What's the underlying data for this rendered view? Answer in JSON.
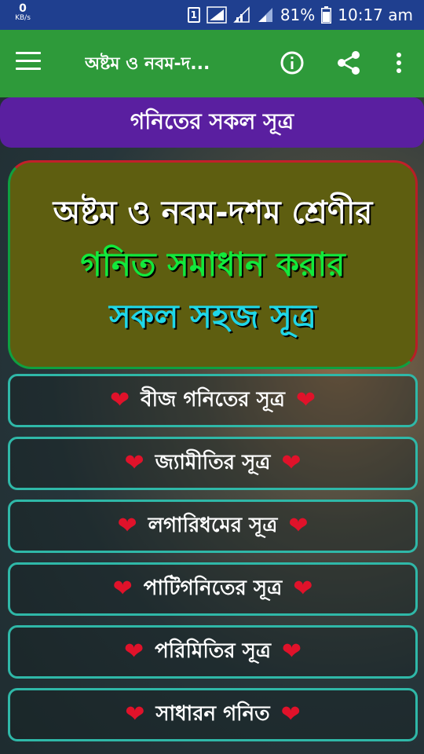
{
  "status_bar": {
    "net_speed_value": "0",
    "net_speed_unit": "KB/s",
    "sim_slot": "1",
    "battery": "81%",
    "time": "10:17 am"
  },
  "toolbar": {
    "title": "অষ্টম ও নবম-দ...",
    "icons": [
      "menu-icon",
      "info-icon",
      "share-icon",
      "more-vert-icon"
    ]
  },
  "heading": "গনিতের সকল সূত্র",
  "banner": {
    "line1": "অষ্টম ও নবম-দশম শ্রেণীর",
    "line2": "গনিত সমাধান করার",
    "line3": "সকল সহজ সূত্র"
  },
  "menu_items": [
    {
      "label": "বীজ গনিতের সূত্র"
    },
    {
      "label": "জ্যামীতির সূত্র"
    },
    {
      "label": "লগারিধমের সূত্র"
    },
    {
      "label": "পাটিগনিতের সূত্র"
    },
    {
      "label": "পরিমিতির সূত্র"
    },
    {
      "label": "সাধারন গনিত"
    }
  ],
  "colors": {
    "status_bar": "#1f3f8f",
    "toolbar": "#2e9a3a",
    "heading_bar": "#5a1fa0",
    "menu_border": "#2fb8a8",
    "heart": "#e0122a"
  }
}
